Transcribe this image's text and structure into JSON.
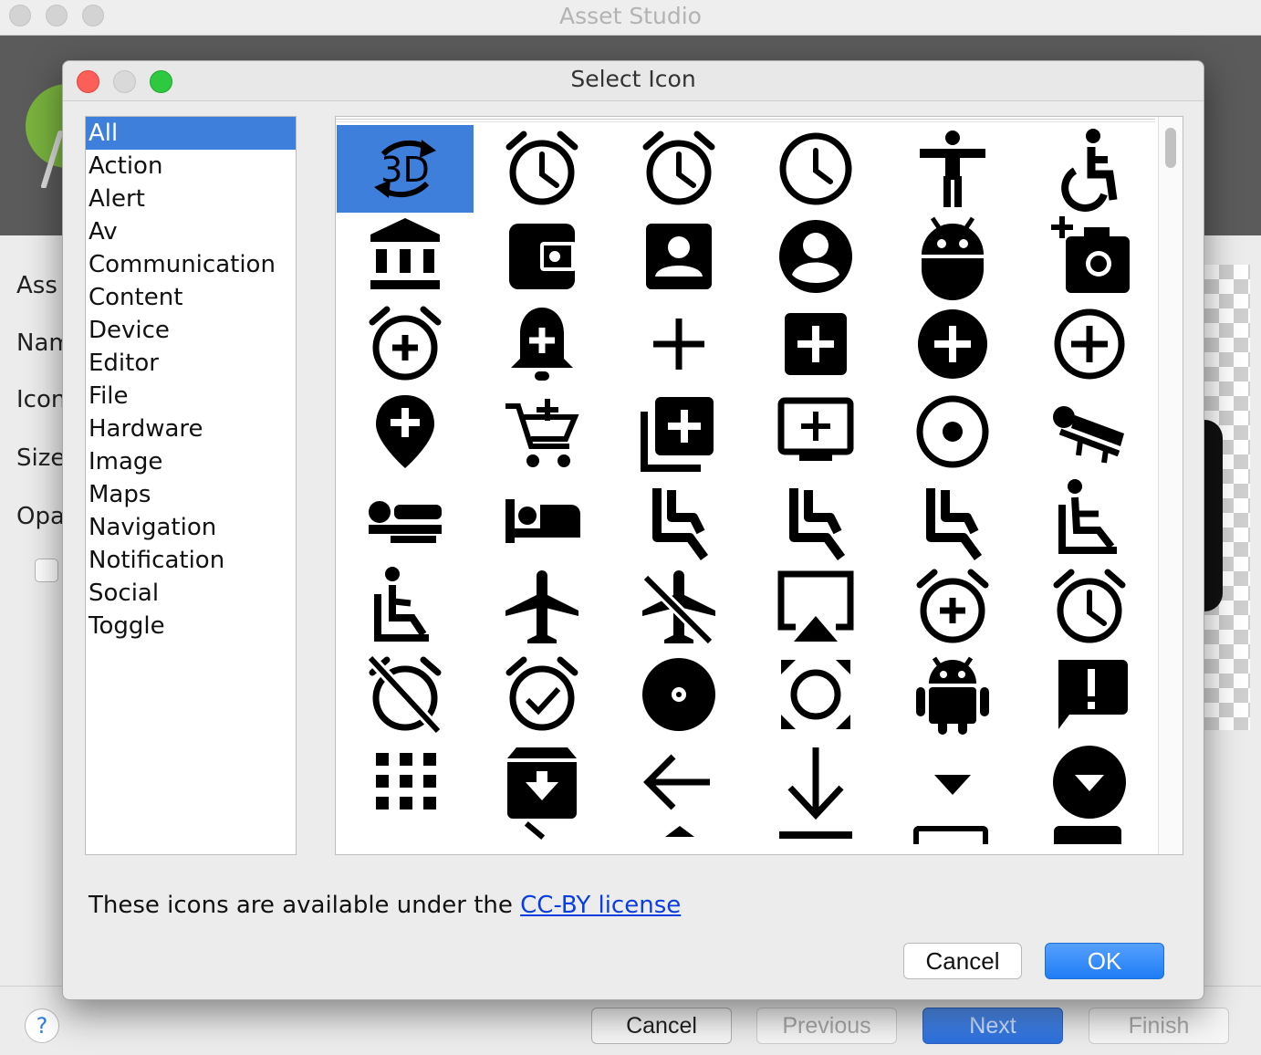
{
  "background_window": {
    "title": "Asset Studio",
    "form_labels": [
      "Ass",
      "Nam",
      "Icon",
      "Size",
      "Opa"
    ],
    "footer_buttons": {
      "help": "?",
      "cancel": "Cancel",
      "previous": "Previous",
      "next": "Next",
      "finish": "Finish"
    }
  },
  "dialog": {
    "title": "Select Icon",
    "categories": [
      "All",
      "Action",
      "Alert",
      "Av",
      "Communication",
      "Content",
      "Device",
      "Editor",
      "File",
      "Hardware",
      "Image",
      "Maps",
      "Navigation",
      "Notification",
      "Social",
      "Toggle"
    ],
    "selected_category": "All",
    "icons": [
      {
        "name": "3d-rotation-icon",
        "label": "3D",
        "selected": true
      },
      {
        "name": "access-alarm-icon"
      },
      {
        "name": "access-alarms-icon"
      },
      {
        "name": "access-time-icon"
      },
      {
        "name": "accessibility-icon"
      },
      {
        "name": "accessible-icon"
      },
      {
        "name": "account-balance-icon"
      },
      {
        "name": "account-balance-wallet-icon"
      },
      {
        "name": "account-box-icon"
      },
      {
        "name": "account-circle-icon"
      },
      {
        "name": "adb-icon"
      },
      {
        "name": "add-a-photo-icon"
      },
      {
        "name": "add-alarm-icon"
      },
      {
        "name": "add-alert-icon"
      },
      {
        "name": "add-icon"
      },
      {
        "name": "add-box-icon"
      },
      {
        "name": "add-circle-icon"
      },
      {
        "name": "add-circle-outline-icon"
      },
      {
        "name": "add-location-icon"
      },
      {
        "name": "add-shopping-cart-icon"
      },
      {
        "name": "add-to-photos-icon"
      },
      {
        "name": "add-to-queue-icon"
      },
      {
        "name": "adjust-icon"
      },
      {
        "name": "airline-seat-flat-angled-icon"
      },
      {
        "name": "airline-seat-flat-icon"
      },
      {
        "name": "airline-seat-individual-suite-icon"
      },
      {
        "name": "airline-seat-legroom-extra-icon"
      },
      {
        "name": "airline-seat-legroom-normal-icon"
      },
      {
        "name": "airline-seat-legroom-reduced-icon"
      },
      {
        "name": "airline-seat-recline-extra-icon"
      },
      {
        "name": "airline-seat-recline-normal-icon"
      },
      {
        "name": "airplanemode-active-icon"
      },
      {
        "name": "airplanemode-inactive-icon"
      },
      {
        "name": "airplay-icon"
      },
      {
        "name": "alarm-add-icon"
      },
      {
        "name": "alarm-icon"
      },
      {
        "name": "alarm-off-icon"
      },
      {
        "name": "alarm-on-icon"
      },
      {
        "name": "album-icon"
      },
      {
        "name": "all-out-icon"
      },
      {
        "name": "android-icon"
      },
      {
        "name": "announcement-icon"
      },
      {
        "name": "apps-icon"
      },
      {
        "name": "archive-icon"
      },
      {
        "name": "arrow-back-icon"
      },
      {
        "name": "arrow-downward-icon"
      },
      {
        "name": "arrow-drop-down-icon"
      },
      {
        "name": "arrow-drop-down-circle-icon"
      }
    ],
    "license_text": "These icons are available under the ",
    "license_link": "CC-BY license",
    "cancel_label": "Cancel",
    "ok_label": "OK"
  }
}
